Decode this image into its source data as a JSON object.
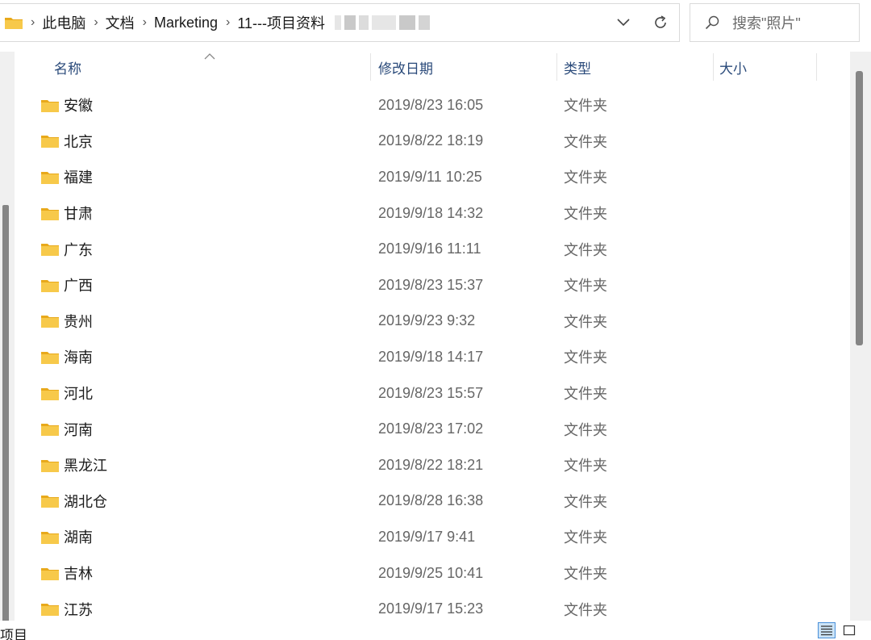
{
  "address": {
    "crumbs": [
      "此电脑",
      "文档",
      "Marketing",
      "11---项目资料"
    ]
  },
  "search": {
    "placeholder": "搜索\"照片\""
  },
  "columns": {
    "name": "名称",
    "date": "修改日期",
    "type": "类型",
    "size": "大小"
  },
  "rows": [
    {
      "name": "安徽",
      "date": "2019/8/23 16:05",
      "type": "文件夹"
    },
    {
      "name": "北京",
      "date": "2019/8/22 18:19",
      "type": "文件夹"
    },
    {
      "name": "福建",
      "date": "2019/9/11 10:25",
      "type": "文件夹"
    },
    {
      "name": "甘肃",
      "date": "2019/9/18 14:32",
      "type": "文件夹"
    },
    {
      "name": "广东",
      "date": "2019/9/16 11:11",
      "type": "文件夹"
    },
    {
      "name": "广西",
      "date": "2019/8/23 15:37",
      "type": "文件夹"
    },
    {
      "name": "贵州",
      "date": "2019/9/23 9:32",
      "type": "文件夹"
    },
    {
      "name": "海南",
      "date": "2019/9/18 14:17",
      "type": "文件夹"
    },
    {
      "name": "河北",
      "date": "2019/8/23 15:57",
      "type": "文件夹"
    },
    {
      "name": "河南",
      "date": "2019/8/23 17:02",
      "type": "文件夹"
    },
    {
      "name": "黑龙江",
      "date": "2019/8/22 18:21",
      "type": "文件夹"
    },
    {
      "name": "湖北仓",
      "date": "2019/8/28 16:38",
      "type": "文件夹"
    },
    {
      "name": "湖南",
      "date": "2019/9/17 9:41",
      "type": "文件夹"
    },
    {
      "name": "吉林",
      "date": "2019/9/25 10:41",
      "type": "文件夹"
    },
    {
      "name": "江苏",
      "date": "2019/9/17 15:23",
      "type": "文件夹"
    }
  ],
  "status": {
    "text": "项目"
  },
  "icons": {
    "folder": "folder-icon",
    "dropdown": "chevron-down-icon",
    "refresh": "refresh-icon",
    "search": "search-icon",
    "sort": "sort-up-caret-icon",
    "details_view": "details-view-icon",
    "large_icons_view": "large-icons-view-icon"
  },
  "colors": {
    "folder": "#f7c94a",
    "folder_dark": "#e8a91b",
    "header_text": "#2a4a7a",
    "accent": "#4a90d9"
  }
}
